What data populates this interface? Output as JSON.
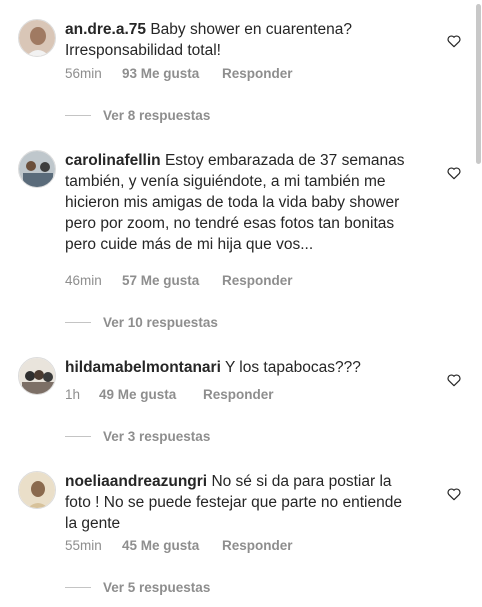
{
  "comments": [
    {
      "username": "an.dre.a.75",
      "text": "Baby shower en cuarentena? Irresponsabilidad total!",
      "time": "56min",
      "likes": "93 Me gusta",
      "reply_label": "Responder",
      "view_replies": "Ver 8 respuestas"
    },
    {
      "username": "carolinafellin",
      "text": "Estoy embarazada de 37 semanas también, y venía siguiéndote, a mi también me hicieron mis amigas de toda la vida baby shower pero por zoom, no tendré esas fotos tan bonitas pero cuide más de mi hija que vos...",
      "time": "46min",
      "likes": "57 Me gusta",
      "reply_label": "Responder",
      "view_replies": "Ver 10 respuestas"
    },
    {
      "username": "hildamabelmontanari",
      "text": "Y los tapabocas???",
      "time": "1h",
      "likes": "49 Me gusta",
      "reply_label": "Responder",
      "view_replies": "Ver 3 respuestas"
    },
    {
      "username": "noeliaandreazungri",
      "text": "No sé si da para postiar la foto ! No se puede festejar que parte no entiende la gente",
      "time": "55min",
      "likes": "45 Me gusta",
      "reply_label": "Responder",
      "view_replies": "Ver 5 respuestas"
    }
  ],
  "icons": {
    "like": "heart-outline-icon",
    "avatar": "profile-photo"
  },
  "colors": {
    "text": "#262626",
    "meta": "#8e8e8e",
    "divider": "#c4c4c4"
  }
}
